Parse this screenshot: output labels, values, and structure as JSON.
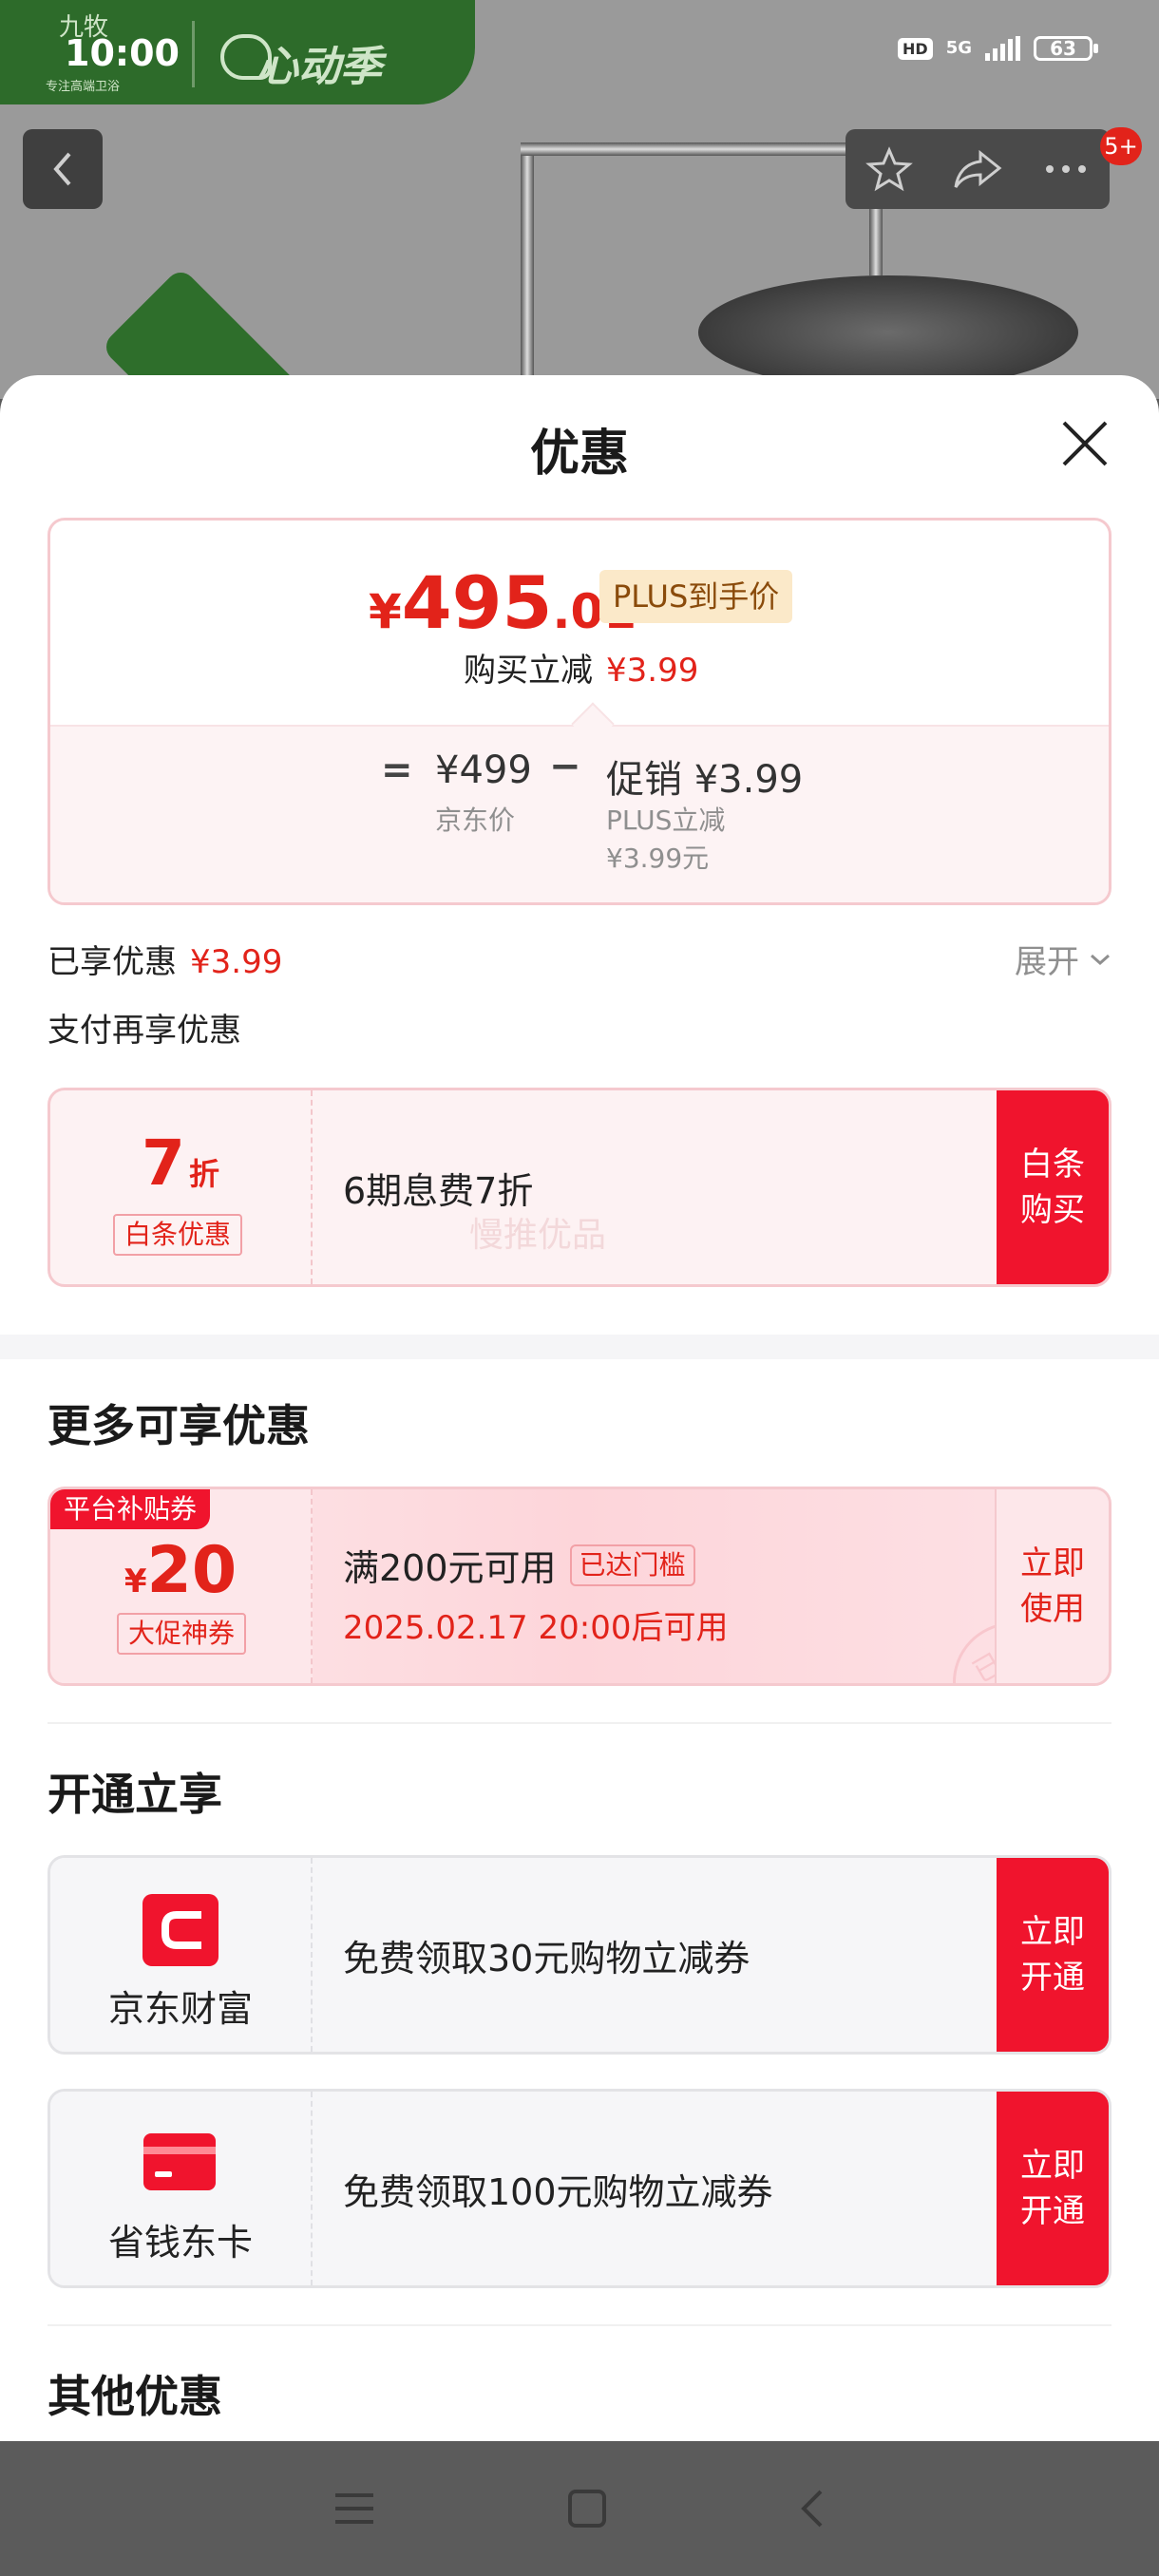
{
  "status_bar": {
    "time": "10:00",
    "hd": "HD",
    "network": "5G",
    "battery": "63"
  },
  "background": {
    "brand_name": "九牧",
    "brand_tagline": "专注高端卫浴",
    "event_name": "心动季",
    "notification_count": "5+",
    "badge_text": "九牧"
  },
  "sheet": {
    "title": "优惠"
  },
  "price_card": {
    "currency": "¥",
    "final_int": "495",
    "final_dec": ".01",
    "plus_tag": "PLUS到手价",
    "buy_save_label": "购买立减",
    "buy_save_value": "¥3.99",
    "equals": "=",
    "jd_price": "¥499",
    "jd_price_label": "京东价",
    "minus": "−",
    "promo": "促销 ¥3.99",
    "promo_sub1": "PLUS立减",
    "promo_sub2": "¥3.99元"
  },
  "enjoyed": {
    "label": "已享优惠",
    "value": "¥3.99",
    "expand_label": "展开"
  },
  "pay_more_label": "支付再享优惠",
  "baitiao": {
    "rate": "7",
    "rate_unit": "折",
    "tag": "白条优惠",
    "desc": "6期息费7折",
    "cta": "白条购买",
    "watermark": "慢推优品"
  },
  "more_offers": {
    "title": "更多可享优惠",
    "coupon": {
      "corner_tag": "平台补贴券",
      "currency": "¥",
      "amount": "20",
      "tag": "大促神券",
      "condition": "满200元可用",
      "threshold": "已达门槛",
      "valid_from": "2025.02.17 20:00后可用",
      "cta": "立即使用",
      "stamp": "已领"
    }
  },
  "open_enjoy": {
    "title": "开通立享",
    "items": [
      {
        "brand": "京东财富",
        "desc": "免费领取30元购物立减券",
        "cta": "立即开通"
      },
      {
        "brand": "省钱东卡",
        "desc": "免费领取100元购物立减券",
        "cta": "立即开通"
      }
    ]
  },
  "other_offers": {
    "title": "其他优惠"
  },
  "colors": {
    "accent_red": "#e2231a",
    "cta_red": "#f0142d",
    "plus_gold_bg": "#fbe9c9"
  }
}
